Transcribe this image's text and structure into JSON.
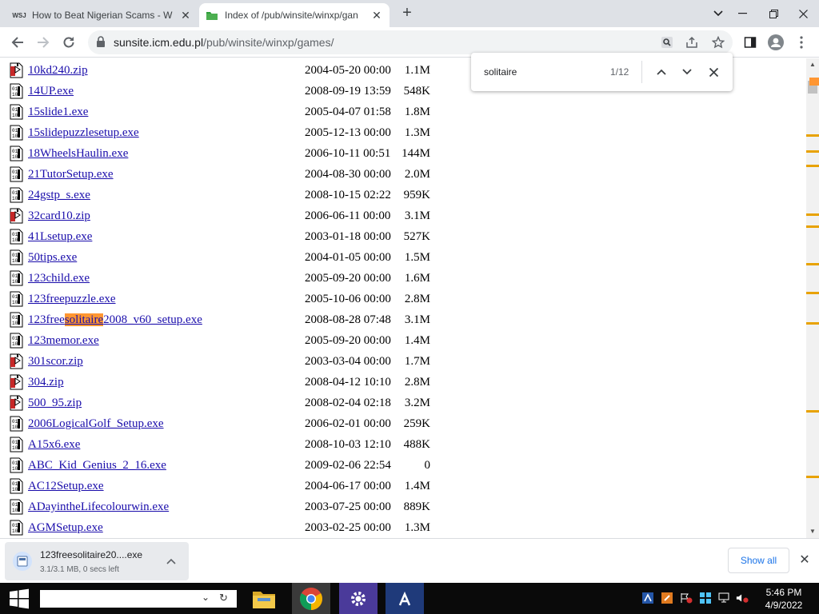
{
  "tabs": [
    {
      "title": "How to Beat Nigerian Scams - W",
      "favicon": "WSJ"
    },
    {
      "title": "Index of /pub/winsite/winxp/gan"
    }
  ],
  "address": {
    "host": "sunsite.icm.edu.pl",
    "path": "/pub/winsite/winxp/games/"
  },
  "find": {
    "query": "solitaire",
    "count": "1/12"
  },
  "files": [
    {
      "pre": "10kd240.zip",
      "hl": "",
      "post": "",
      "date": "2004-05-20 00:00",
      "size": "1.1M",
      "type": "zip"
    },
    {
      "pre": "14UP.exe",
      "hl": "",
      "post": "",
      "date": "2008-09-19 13:59",
      "size": "548K",
      "type": "exe"
    },
    {
      "pre": "15slide1.exe",
      "hl": "",
      "post": "",
      "date": "2005-04-07 01:58",
      "size": "1.8M",
      "type": "exe"
    },
    {
      "pre": "15slidepuzzlesetup.exe",
      "hl": "",
      "post": "",
      "date": "2005-12-13 00:00",
      "size": "1.3M",
      "type": "exe"
    },
    {
      "pre": "18WheelsHaulin.exe",
      "hl": "",
      "post": "",
      "date": "2006-10-11 00:51",
      "size": "144M",
      "type": "exe"
    },
    {
      "pre": "21TutorSetup.exe",
      "hl": "",
      "post": "",
      "date": "2004-08-30 00:00",
      "size": "2.0M",
      "type": "exe"
    },
    {
      "pre": "24gstp_s.exe",
      "hl": "",
      "post": "",
      "date": "2008-10-15 02:22",
      "size": "959K",
      "type": "exe"
    },
    {
      "pre": "32card10.zip",
      "hl": "",
      "post": "",
      "date": "2006-06-11 00:00",
      "size": "3.1M",
      "type": "zip"
    },
    {
      "pre": "41Lsetup.exe",
      "hl": "",
      "post": "",
      "date": "2003-01-18 00:00",
      "size": "527K",
      "type": "exe"
    },
    {
      "pre": "50tips.exe",
      "hl": "",
      "post": "",
      "date": "2004-01-05 00:00",
      "size": "1.5M",
      "type": "exe"
    },
    {
      "pre": "123child.exe",
      "hl": "",
      "post": "",
      "date": "2005-09-20 00:00",
      "size": "1.6M",
      "type": "exe"
    },
    {
      "pre": "123freepuzzle.exe",
      "hl": "",
      "post": "",
      "date": "2005-10-06 00:00",
      "size": "2.8M",
      "type": "exe"
    },
    {
      "pre": "123free",
      "hl": "solitaire",
      "post": "2008_v60_setup.exe",
      "date": "2008-08-28 07:48",
      "size": "3.1M",
      "type": "exe"
    },
    {
      "pre": "123memor.exe",
      "hl": "",
      "post": "",
      "date": "2005-09-20 00:00",
      "size": "1.4M",
      "type": "exe"
    },
    {
      "pre": "301scor.zip",
      "hl": "",
      "post": "",
      "date": "2003-03-04 00:00",
      "size": "1.7M",
      "type": "zip"
    },
    {
      "pre": "304.zip",
      "hl": "",
      "post": "",
      "date": "2008-04-12 10:10",
      "size": "2.8M",
      "type": "zip"
    },
    {
      "pre": "500_95.zip",
      "hl": "",
      "post": "",
      "date": "2008-02-04 02:18",
      "size": "3.2M",
      "type": "zip"
    },
    {
      "pre": "2006LogicalGolf_Setup.exe",
      "hl": "",
      "post": "",
      "date": "2006-02-01 00:00",
      "size": "259K",
      "type": "exe"
    },
    {
      "pre": "A15x6.exe",
      "hl": "",
      "post": "",
      "date": "2008-10-03 12:10",
      "size": "488K",
      "type": "exe"
    },
    {
      "pre": "ABC_Kid_Genius_2_16.exe",
      "hl": "",
      "post": "",
      "date": "2009-02-06 22:54",
      "size": "0",
      "type": "exe"
    },
    {
      "pre": "AC12Setup.exe",
      "hl": "",
      "post": "",
      "date": "2004-06-17 00:00",
      "size": "1.4M",
      "type": "exe"
    },
    {
      "pre": "ADayintheLifecolourwin.exe",
      "hl": "",
      "post": "",
      "date": "2003-07-25 00:00",
      "size": "889K",
      "type": "exe"
    },
    {
      "pre": "AGMSetup.exe",
      "hl": "",
      "post": "",
      "date": "2003-02-25 00:00",
      "size": "1.3M",
      "type": "exe"
    }
  ],
  "download": {
    "name": "123freesolitaire20....exe",
    "status": "3.1/3.1 MB, 0 secs left"
  },
  "shelf": {
    "show_all": "Show all"
  },
  "clock": {
    "time": "5:46 PM",
    "date": "4/9/2022"
  },
  "colors": {
    "link": "#1a0dab",
    "highlight": "#ff9632",
    "find_marker": "#e8a200"
  }
}
